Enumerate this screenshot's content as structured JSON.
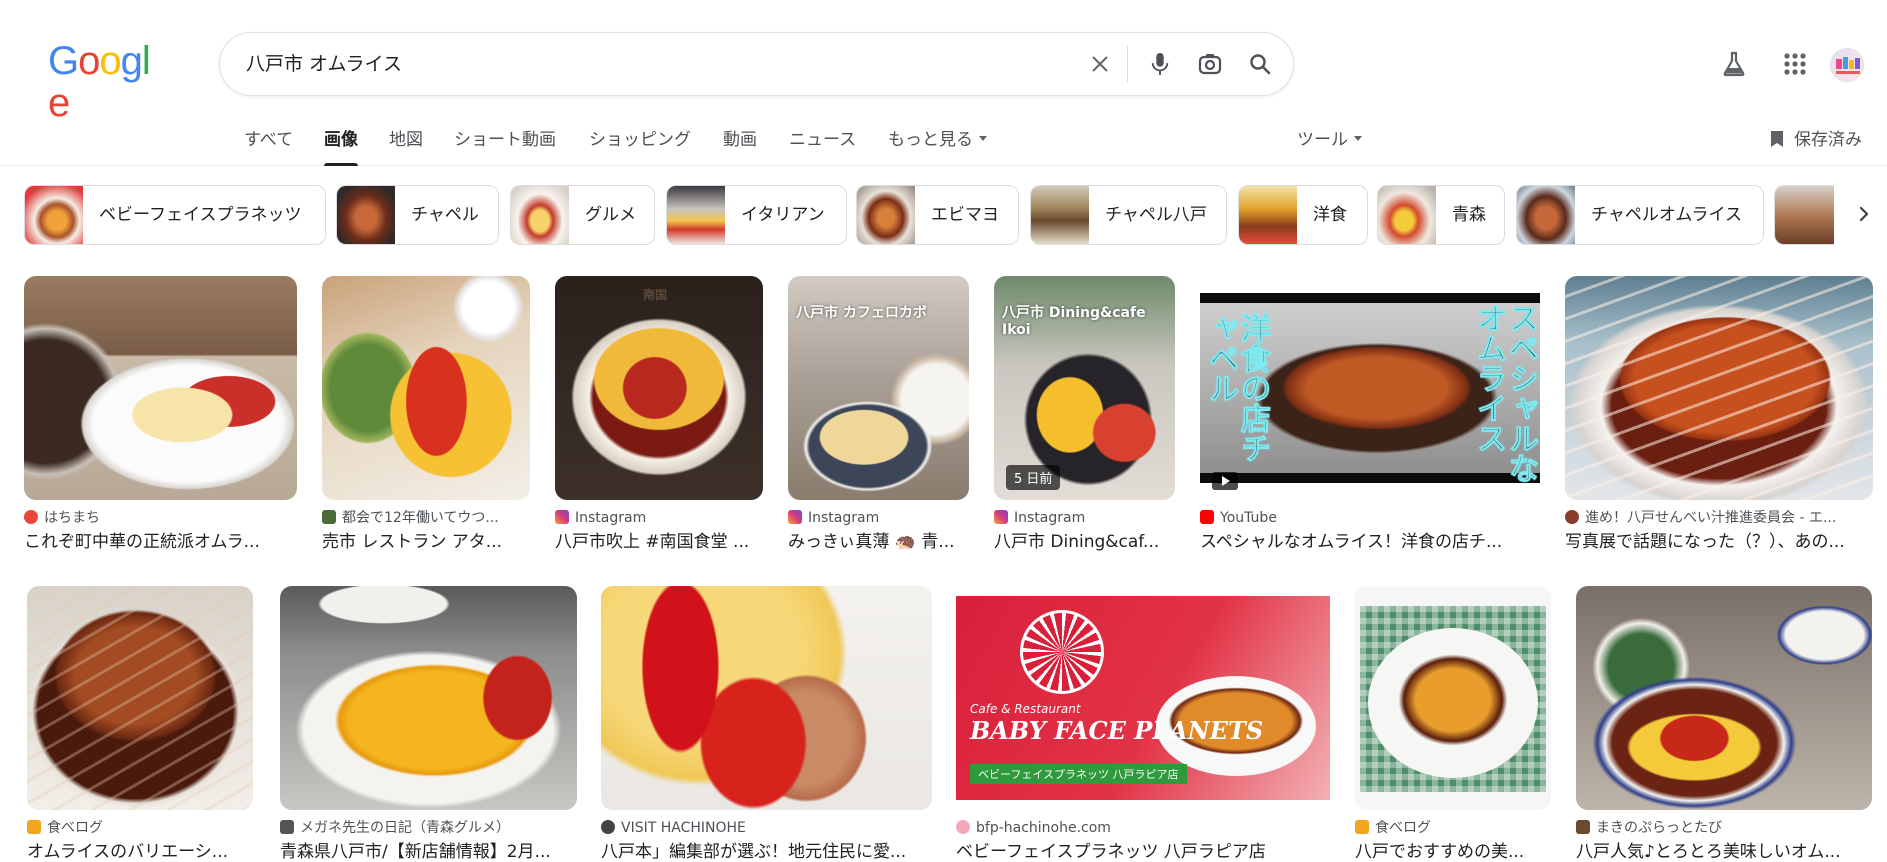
{
  "logo": {
    "letters": [
      "G",
      "o",
      "o",
      "g",
      "l",
      "e"
    ],
    "colors": [
      "#4285F4",
      "#EA4335",
      "#FBBC05",
      "#4285F4",
      "#34A853",
      "#EA4335"
    ]
  },
  "search": {
    "query": "八戸市 オムライス"
  },
  "icons": {
    "clear": "close-icon",
    "voice": "microphone-icon",
    "lens": "camera-icon",
    "search": "search-icon",
    "labs": "flask-icon",
    "apps": "apps-grid-icon",
    "next": "chevron-right-icon",
    "bookmark": "bookmark-icon"
  },
  "tabs": [
    {
      "label": "すべて"
    },
    {
      "label": "画像"
    },
    {
      "label": "地図"
    },
    {
      "label": "ショート動画"
    },
    {
      "label": "ショッピング"
    },
    {
      "label": "動画"
    },
    {
      "label": "ニュース"
    },
    {
      "label": "もっと見る"
    }
  ],
  "tools_label": "ツール",
  "saved_label": "保存済み",
  "chips": [
    {
      "label": "ベビーフェイスプラネッツ"
    },
    {
      "label": "チャペル"
    },
    {
      "label": "グルメ"
    },
    {
      "label": "イタリアン"
    },
    {
      "label": "エビマヨ"
    },
    {
      "label": "チャペル八戸"
    },
    {
      "label": "洋食"
    },
    {
      "label": "青森"
    },
    {
      "label": "チャペルオムライス"
    }
  ],
  "results_row1": [
    {
      "source": "はちまち",
      "title": "これぞ町中華の正統派オムラ..."
    },
    {
      "source": "都会で12年働いてウつ...",
      "title": "売市 レストラン アタ..."
    },
    {
      "source": "Instagram",
      "title": "八戸市吹上 #南国食堂 ..."
    },
    {
      "source": "Instagram",
      "title": "みっきぃ真薄 🦔 青..."
    },
    {
      "source": "Instagram",
      "title": "八戸市 Dining&caf...",
      "badge": "5 日前",
      "overlay": "八戸市 Dining&cafe Ikoi"
    },
    {
      "source": "YouTube",
      "title": "スペシャルなオムライス！洋食の店チ...",
      "vtext_left": "洋食の店チャペル",
      "vtext_right": "スペシャルなオムライス"
    },
    {
      "source": "進め！八戸せんべい汁推進委員会 - エ...",
      "title": "写真展で話題になった（？）、あの..."
    }
  ],
  "results_row1_overlay_cafe": "八戸市 カフェロカボ",
  "results_row2": [
    {
      "source": "食べログ",
      "title": "オムライスのバリエーシ..."
    },
    {
      "source": "メガネ先生の日記（青森グルメ）",
      "title": "青森県八戸市/【新店舗情報】2月..."
    },
    {
      "source": "VISIT HACHINOHE",
      "title": "八戸本」編集部が選ぶ！地元住民に愛..."
    },
    {
      "source": "bfp-hachinohe.com",
      "title": "ベビーフェイスプラネッツ 八戸ラピア店",
      "brand": "BABY FACE PLANETS",
      "banner": "ベビーフェイスプラネッツ 八戸ラピア店",
      "cafe": "Cafe & Restaurant"
    },
    {
      "source": "食べログ",
      "title": "八戸でおすすめの美..."
    },
    {
      "source": "まきのぷらっとたび",
      "title": "八戸人気♪とろとろ美味しいオム..."
    }
  ]
}
